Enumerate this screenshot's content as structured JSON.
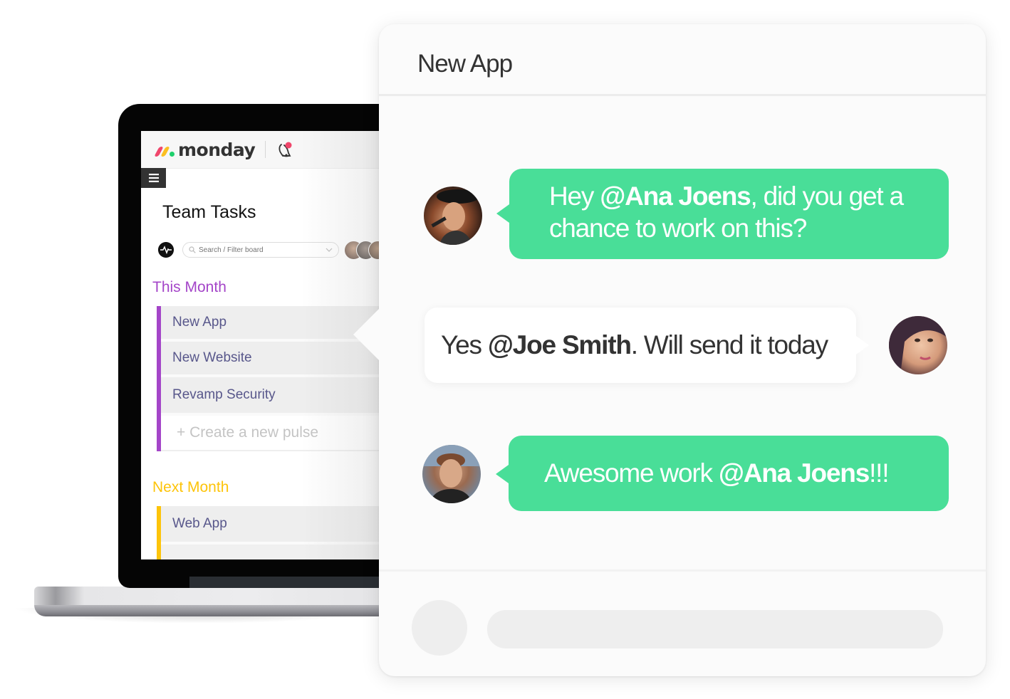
{
  "laptop": {
    "brand": {
      "name": "monday",
      "colors": [
        "#f0466b",
        "#fbbf21",
        "#1fd06c"
      ]
    },
    "header_icons": [
      "bell-icon"
    ],
    "menu_icon": "hamburger-icon",
    "board": {
      "title": "Team Tasks",
      "search_placeholder": "Search / Filter board",
      "activity_icon": "activity-pulse-icon",
      "groups": [
        {
          "title": "This Month",
          "color": "#a445c8",
          "items": [
            "New App",
            "New Website",
            "Revamp Security"
          ],
          "create_label": "+ Create a new pulse"
        },
        {
          "title": "Next Month",
          "color": "#fdc40a",
          "items": [
            "Web App"
          ]
        }
      ]
    }
  },
  "chat": {
    "title": "New App",
    "accent": "#49de98",
    "messages": [
      {
        "side": "left",
        "style": "green",
        "avatar": "avatar-joe-smith",
        "parts": [
          {
            "text": "Hey ",
            "bold": false
          },
          {
            "text": "@Ana Joens",
            "bold": true
          },
          {
            "text": ", did you get a chance to work on this?",
            "bold": false
          }
        ]
      },
      {
        "side": "right",
        "style": "white",
        "avatar": "avatar-ana-joens",
        "parts": [
          {
            "text": "Yes ",
            "bold": false
          },
          {
            "text": "@Joe Smith",
            "bold": true
          },
          {
            "text": ". Will send it today",
            "bold": false
          }
        ]
      },
      {
        "side": "left",
        "style": "green",
        "avatar": "avatar-teammate",
        "parts": [
          {
            "text": "Awesome work ",
            "bold": false
          },
          {
            "text": "@Ana Joens",
            "bold": true
          },
          {
            "text": "!!!",
            "bold": false
          }
        ]
      }
    ],
    "composer": {
      "placeholder": ""
    }
  }
}
